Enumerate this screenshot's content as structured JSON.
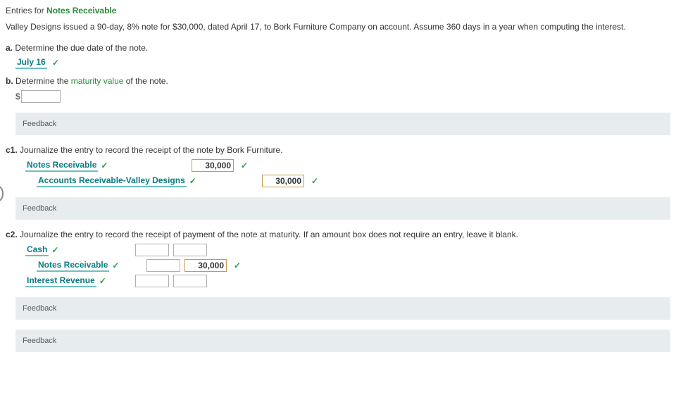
{
  "title": {
    "t1": "Entries for ",
    "t2": "Notes Receivable"
  },
  "problem": "Valley Designs issued a 90-day, 8% note for $30,000, dated April 17, to Bork Furniture Company on account. Assume 360 days in a year when computing the interest.",
  "a": {
    "label_prefix": "a.",
    "text": "Determine the due date of the note.",
    "answer": "July 16"
  },
  "b": {
    "label_prefix": "b.",
    "text_pre": "Determine the ",
    "green": "maturity value",
    "text_post": " of the note.",
    "dollar": "$",
    "value": ""
  },
  "feedback": "Feedback",
  "c1": {
    "label_prefix": "c1.",
    "text": "Journalize the entry to record the receipt of the note by Bork Furniture.",
    "row1_label": "Notes Receivable",
    "row1_val": "30,000",
    "row2_label": "Accounts Receivable-Valley Designs",
    "row2_val": "30,000"
  },
  "c2": {
    "label_prefix": "c2.",
    "text": "Journalize the entry to record the receipt of payment of the note at maturity. If an amount box does not require an entry, leave it blank.",
    "rows": [
      {
        "label": "Cash",
        "indent": false,
        "v1": "",
        "v2": ""
      },
      {
        "label": "Notes Receivable",
        "indent": true,
        "v1": "",
        "v2": "30,000"
      },
      {
        "label": "Interest Revenue",
        "indent": false,
        "v1": "",
        "v2": ""
      }
    ]
  }
}
